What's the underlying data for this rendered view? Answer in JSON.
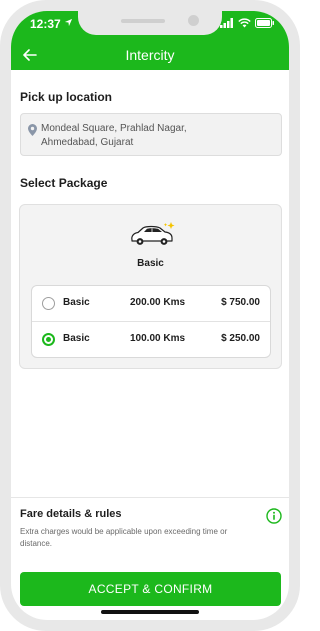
{
  "status_bar": {
    "time": "12:37"
  },
  "app_bar": {
    "title": "Intercity"
  },
  "pickup": {
    "label": "Pick up location",
    "address_line1": "Mondeal Square, Prahlad Nagar,",
    "address_line2": "Ahmedabad, Gujarat"
  },
  "package": {
    "label": "Select Package",
    "name": "Basic",
    "options": [
      {
        "name": "Basic",
        "distance": "200.00 Kms",
        "price": "$ 750.00",
        "selected": false
      },
      {
        "name": "Basic",
        "distance": "100.00 Kms",
        "price": "$ 250.00",
        "selected": true
      }
    ]
  },
  "fare": {
    "title": "Fare details & rules",
    "description": "Extra charges would be applicable upon exceeding time or distance."
  },
  "accept_button": {
    "label": "ACCEPT & CONFIRM"
  },
  "colors": {
    "accent": "#1cb81c",
    "icons": [
      "back-arrow-icon",
      "location-pin-icon",
      "car-icon",
      "info-icon",
      "wifi-icon",
      "battery-icon",
      "signal-icon"
    ]
  }
}
